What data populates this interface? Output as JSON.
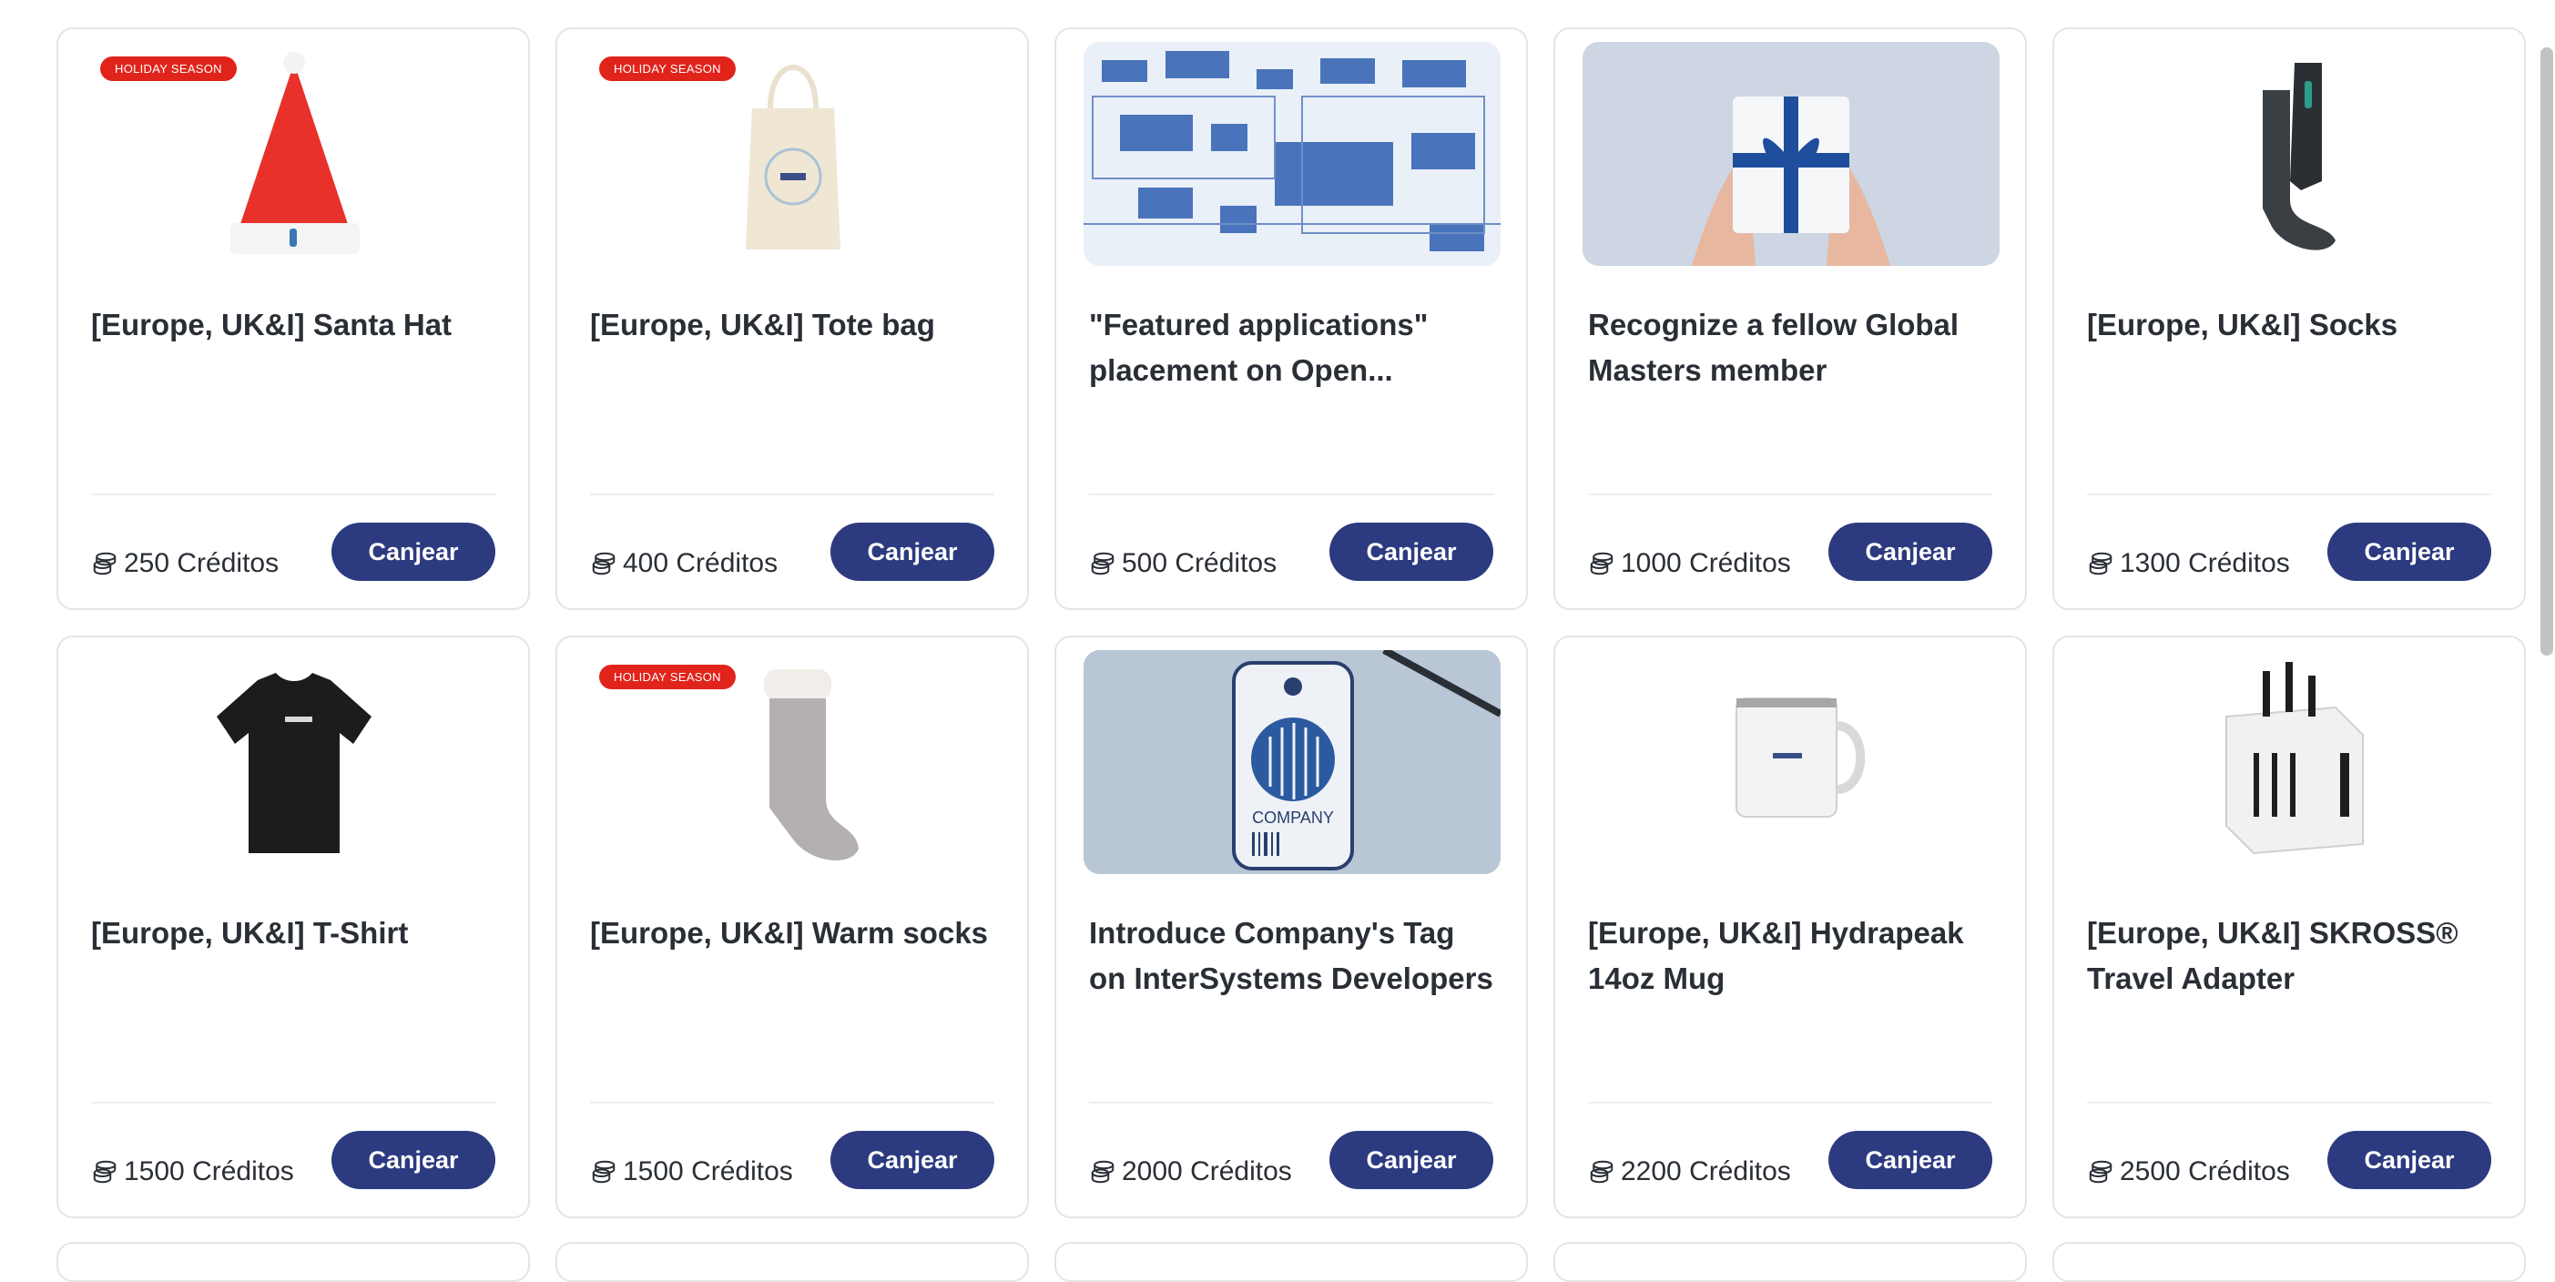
{
  "cards": [
    {
      "title": "[Europe, UK&I] Santa Hat",
      "badge": "HOLIDAY SEASON",
      "price": "250 Créditos",
      "button": "Canjear",
      "image": "santa-hat-image"
    },
    {
      "title": "[Europe, UK&I] Tote bag",
      "badge": "HOLIDAY SEASON",
      "price": "400 Créditos",
      "button": "Canjear",
      "image": "tote-bag-image"
    },
    {
      "title": "\"Featured applications\" placement on Open...",
      "badge": "",
      "price": "500 Créditos",
      "button": "Canjear",
      "image": "blueprint-image"
    },
    {
      "title": "Recognize a fellow Global Masters member",
      "badge": "",
      "price": "1000 Créditos",
      "button": "Canjear",
      "image": "gift-box-image"
    },
    {
      "title": "[Europe, UK&I] Socks",
      "badge": "",
      "price": "1300 Créditos",
      "button": "Canjear",
      "image": "socks-image"
    },
    {
      "title": "[Europe, UK&I] T-Shirt",
      "badge": "",
      "price": "1500 Créditos",
      "button": "Canjear",
      "image": "t-shirt-image"
    },
    {
      "title": "[Europe, UK&I] Warm socks",
      "badge": "HOLIDAY SEASON",
      "price": "1500 Créditos",
      "button": "Canjear",
      "image": "warm-sock-image"
    },
    {
      "title": "Introduce Company's Tag on InterSystems Developers",
      "badge": "",
      "price": "2000 Créditos",
      "button": "Canjear",
      "image": "company-tag-image",
      "image_text": "COMPANY"
    },
    {
      "title": "[Europe, UK&I] Hydrapeak 14oz Mug",
      "badge": "",
      "price": "2200 Créditos",
      "button": "Canjear",
      "image": "mug-image"
    },
    {
      "title": "[Europe, UK&I] SKROSS® Travel Adapter",
      "badge": "",
      "price": "2500 Créditos",
      "button": "Canjear",
      "image": "travel-adapter-image"
    }
  ],
  "colors": {
    "button": "#2c3a80",
    "badge": "#e1241b",
    "border": "#e4e4e7",
    "text": "#2a2f36"
  }
}
